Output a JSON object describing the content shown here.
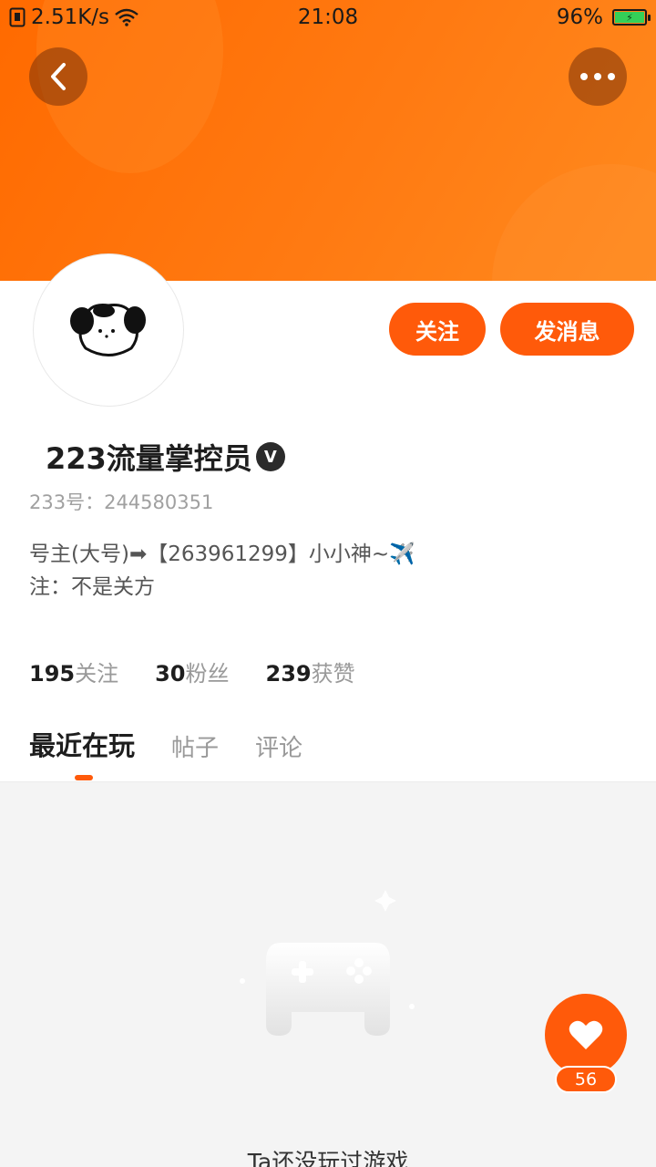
{
  "status_bar": {
    "network_speed": "2.51K/s",
    "time": "21:08",
    "battery": "96%"
  },
  "header": {
    "back_icon": "chevron-left-icon",
    "more_icon": "more-horizontal-icon"
  },
  "profile": {
    "follow_label": "关注",
    "message_label": "发消息",
    "name": "223流量掌控员",
    "verified_badge": "V",
    "uid": "233号：244580351",
    "bio_line1": "号主(大号)➡【263961299】小小神~✈️",
    "bio_line2": "注：不是关方"
  },
  "stats": [
    {
      "value": "195",
      "label": "关注"
    },
    {
      "value": "30",
      "label": "粉丝"
    },
    {
      "value": "239",
      "label": "获赞"
    }
  ],
  "tabs": [
    "最近在玩",
    "帖子",
    "评论"
  ],
  "empty": {
    "icon": "gamepad-icon",
    "text": "Ta还没玩过游戏"
  },
  "like": {
    "icon": "heart-icon",
    "count": "56"
  },
  "colors": {
    "accent": "#ff5a0a",
    "banner_start": "#ff6a00",
    "banner_end": "#ff8a1e"
  }
}
